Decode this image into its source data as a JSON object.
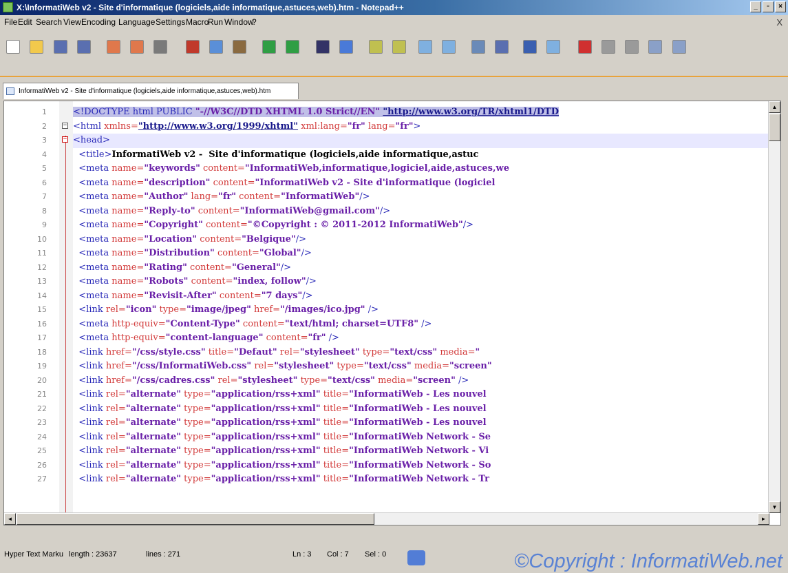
{
  "window": {
    "title": "X:\\InformatiWeb v2 - Site d'informatique (logiciels,aide informatique,astuces,web).htm - Notepad++"
  },
  "menu": [
    "File",
    "Edit",
    "Search",
    "View",
    "Encoding",
    "Language",
    "Settings",
    "Macro",
    "Run",
    "Window",
    "?"
  ],
  "menu_close": "X",
  "tab": {
    "label": "InformatiWeb v2 - Site d'informatique (logiciels,aide informatique,astuces,web).htm"
  },
  "lines": [
    {
      "n": "1",
      "html": "<span class='sel'><span class='tag'>&lt;!DOCTYPE html PUBLIC </span><span class='val'>\"-//W3C//DTD XHTML 1.0 Strict//EN\"</span> <span class='link'>\"http://www.w3.org/TR/xhtml1/DTD</span></span>"
    },
    {
      "n": "2",
      "fold": "-",
      "html": "<span class='tag'>&lt;html </span><span class='attr'>xmlns=</span><span class='link'>\"http://www.w3.org/1999/xhtml\"</span><span class='attr'> xml:lang=</span><span class='val'>\"fr\"</span><span class='attr'> lang=</span><span class='val'>\"fr\"</span><span class='tag'>&gt;</span>"
    },
    {
      "n": "3",
      "fold": "-",
      "red": true,
      "cur": true,
      "html": "<span class='tag'>&lt;head&gt;</span>"
    },
    {
      "n": "4",
      "html": "<span class='tag'>  &lt;title&gt;</span><span class='txt'>InformatiWeb v2 -  Site d'informatique (logiciels,aide informatique,astuc</span>"
    },
    {
      "n": "5",
      "html": "<span class='tag'>  &lt;meta </span><span class='attr'>name=</span><span class='val'>\"keywords\"</span><span class='attr'> content=</span><span class='val'>\"InformatiWeb,informatique,logiciel,aide,astuces,we</span>"
    },
    {
      "n": "6",
      "html": "<span class='tag'>  &lt;meta </span><span class='attr'>name=</span><span class='val'>\"description\"</span><span class='attr'> content=</span><span class='val'>\"InformatiWeb v2 - Site d'informatique (logiciel</span>"
    },
    {
      "n": "7",
      "html": "<span class='tag'>  &lt;meta </span><span class='attr'>name=</span><span class='val'>\"Author\"</span><span class='attr'> lang=</span><span class='val'>\"fr\"</span><span class='attr'> content=</span><span class='val'>\"InformatiWeb\"</span><span class='tag'>/&gt;</span>"
    },
    {
      "n": "8",
      "html": "<span class='tag'>  &lt;meta </span><span class='attr'>name=</span><span class='val'>\"Reply-to\"</span><span class='attr'> content=</span><span class='val'>\"InformatiWeb@gmail.com\"</span><span class='tag'>/&gt;</span>"
    },
    {
      "n": "9",
      "html": "<span class='tag'>  &lt;meta </span><span class='attr'>name=</span><span class='val'>\"Copyright\"</span><span class='attr'> content=</span><span class='val'>\"©Copyright : © 2011-2012 InformatiWeb\"</span><span class='tag'>/&gt;</span>"
    },
    {
      "n": "10",
      "html": "<span class='tag'>  &lt;meta </span><span class='attr'>name=</span><span class='val'>\"Location\"</span><span class='attr'> content=</span><span class='val'>\"Belgique\"</span><span class='tag'>/&gt;</span>"
    },
    {
      "n": "11",
      "html": "<span class='tag'>  &lt;meta </span><span class='attr'>name=</span><span class='val'>\"Distribution\"</span><span class='attr'> content=</span><span class='val'>\"Global\"</span><span class='tag'>/&gt;</span>"
    },
    {
      "n": "12",
      "html": "<span class='tag'>  &lt;meta </span><span class='attr'>name=</span><span class='val'>\"Rating\"</span><span class='attr'> content=</span><span class='val'>\"General\"</span><span class='tag'>/&gt;</span>"
    },
    {
      "n": "13",
      "html": "<span class='tag'>  &lt;meta </span><span class='attr'>name=</span><span class='val'>\"Robots\"</span><span class='attr'> content=</span><span class='val'>\"index, follow\"</span><span class='tag'>/&gt;</span>"
    },
    {
      "n": "14",
      "html": "<span class='tag'>  &lt;meta </span><span class='attr'>name=</span><span class='val'>\"Revisit-After\"</span><span class='attr'> content=</span><span class='val'>\"7 days\"</span><span class='tag'>/&gt;</span>"
    },
    {
      "n": "15",
      "html": "<span class='tag'>  &lt;link </span><span class='attr'>rel=</span><span class='val'>\"icon\"</span><span class='attr'> type=</span><span class='val'>\"image/jpeg\"</span><span class='attr'> href=</span><span class='val'>\"/images/ico.jpg\"</span><span class='tag'> /&gt;</span>"
    },
    {
      "n": "16",
      "html": "<span class='tag'>  &lt;meta </span><span class='attr'>http-equiv=</span><span class='val'>\"Content-Type\"</span><span class='attr'> content=</span><span class='val'>\"text/html; charset=UTF8\"</span><span class='tag'> /&gt;</span>"
    },
    {
      "n": "17",
      "html": "<span class='tag'>  &lt;meta </span><span class='attr'>http-equiv=</span><span class='val'>\"content-language\"</span><span class='attr'> content=</span><span class='val'>\"fr\"</span><span class='tag'> /&gt;</span>"
    },
    {
      "n": "18",
      "html": "<span class='tag'>  &lt;link </span><span class='attr'>href=</span><span class='val'>\"/css/style.css\"</span><span class='attr'> title=</span><span class='val'>\"Defaut\"</span><span class='attr'> rel=</span><span class='val'>\"stylesheet\"</span><span class='attr'> type=</span><span class='val'>\"text/css\"</span><span class='attr'> media=</span><span class='val'>\"</span>"
    },
    {
      "n": "19",
      "html": "<span class='tag'>  &lt;link </span><span class='attr'>href=</span><span class='val'>\"/css/InformatiWeb.css\"</span><span class='attr'> rel=</span><span class='val'>\"stylesheet\"</span><span class='attr'> type=</span><span class='val'>\"text/css\"</span><span class='attr'> media=</span><span class='val'>\"screen\"</span>"
    },
    {
      "n": "20",
      "html": "<span class='tag'>  &lt;link </span><span class='attr'>href=</span><span class='val'>\"/css/cadres.css\"</span><span class='attr'> rel=</span><span class='val'>\"stylesheet\"</span><span class='attr'> type=</span><span class='val'>\"text/css\"</span><span class='attr'> media=</span><span class='val'>\"screen\"</span><span class='tag'> /&gt;</span>"
    },
    {
      "n": "21",
      "html": "<span class='tag'>  &lt;link </span><span class='attr'>rel=</span><span class='val'>\"alternate\"</span><span class='attr'> type=</span><span class='val'>\"application/rss+xml\"</span><span class='attr'> title=</span><span class='val'>\"InformatiWeb - Les nouvel</span>"
    },
    {
      "n": "22",
      "html": "<span class='tag'>  &lt;link </span><span class='attr'>rel=</span><span class='val'>\"alternate\"</span><span class='attr'> type=</span><span class='val'>\"application/rss+xml\"</span><span class='attr'> title=</span><span class='val'>\"InformatiWeb - Les nouvel</span>"
    },
    {
      "n": "23",
      "html": "<span class='tag'>  &lt;link </span><span class='attr'>rel=</span><span class='val'>\"alternate\"</span><span class='attr'> type=</span><span class='val'>\"application/rss+xml\"</span><span class='attr'> title=</span><span class='val'>\"InformatiWeb - Les nouvel</span>"
    },
    {
      "n": "24",
      "html": "<span class='tag'>  &lt;link </span><span class='attr'>rel=</span><span class='val'>\"alternate\"</span><span class='attr'> type=</span><span class='val'>\"application/rss+xml\"</span><span class='attr'> title=</span><span class='val'>\"InformatiWeb Network - Se</span>"
    },
    {
      "n": "25",
      "html": "<span class='tag'>  &lt;link </span><span class='attr'>rel=</span><span class='val'>\"alternate\"</span><span class='attr'> type=</span><span class='val'>\"application/rss+xml\"</span><span class='attr'> title=</span><span class='val'>\"InformatiWeb Network - Vi</span>"
    },
    {
      "n": "26",
      "html": "<span class='tag'>  &lt;link </span><span class='attr'>rel=</span><span class='val'>\"alternate\"</span><span class='attr'> type=</span><span class='val'>\"application/rss+xml\"</span><span class='attr'> title=</span><span class='val'>\"InformatiWeb Network - So</span>"
    },
    {
      "n": "27",
      "html": "<span class='tag'>  &lt;link </span><span class='attr'>rel=</span><span class='val'>\"alternate\"</span><span class='attr'> type=</span><span class='val'>\"application/rss+xml\"</span><span class='attr'> title=</span><span class='val'>\"InformatiWeb Network - Tr</span>"
    }
  ],
  "status": {
    "type": "Hyper Text Marku",
    "length": "length : 23637",
    "lines": "lines : 271",
    "ln": "Ln : 3",
    "col": "Col : 7",
    "sel": "Sel : 0"
  },
  "watermark": "©Copyright : InformatiWeb.net",
  "toolbar_icons": [
    "new-file-icon",
    "open-file-icon",
    "save-icon",
    "save-all-icon",
    "close-icon",
    "close-all-icon",
    "print-icon",
    "cut-icon",
    "copy-icon",
    "paste-icon",
    "undo-icon",
    "redo-icon",
    "find-icon",
    "replace-icon",
    "zoom-in-icon",
    "zoom-out-icon",
    "sync-v-icon",
    "sync-h-icon",
    "word-wrap-icon",
    "show-all-chars-icon",
    "indent-guide-icon",
    "doc-map-icon",
    "record-macro-icon",
    "stop-macro-icon",
    "play-macro-icon",
    "run-macro-multiple-icon",
    "save-macro-icon"
  ]
}
